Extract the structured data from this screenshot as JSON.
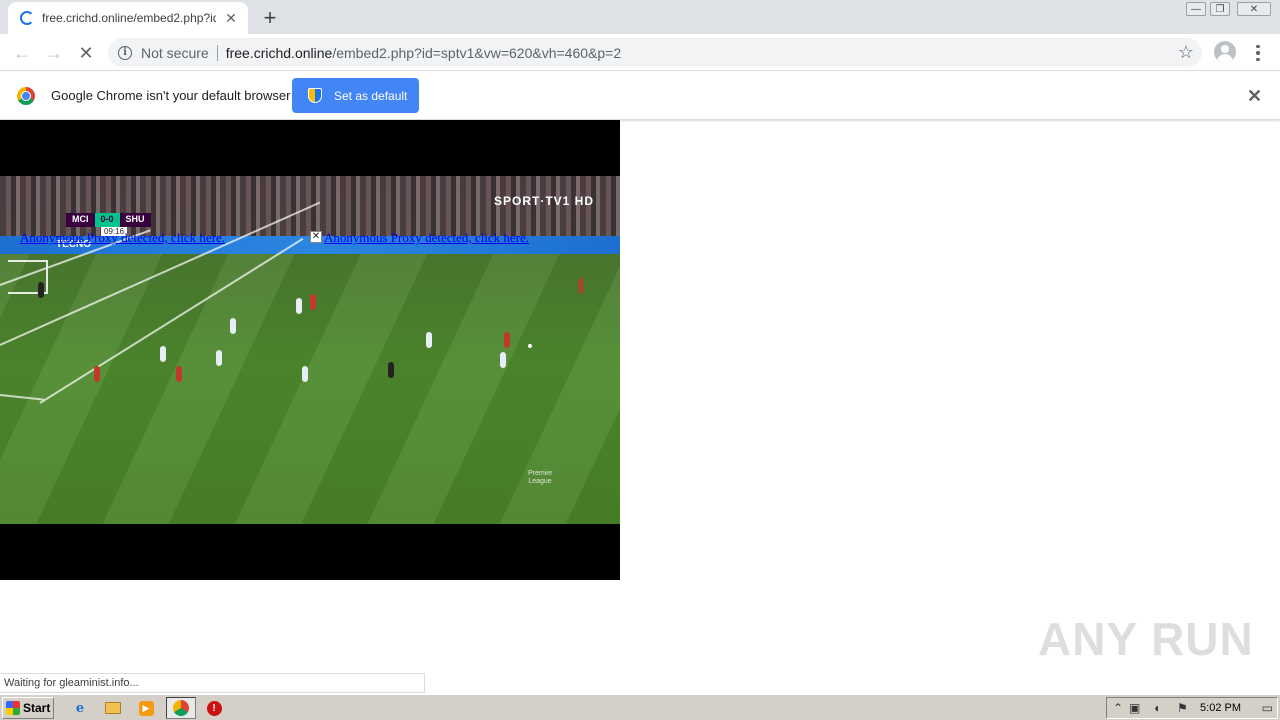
{
  "browser": {
    "tab_title": "free.crichd.online/embed2.php?id=sp",
    "tab_close": "✕",
    "new_tab": "+",
    "win_min": "—",
    "win_restore": "❐",
    "win_close": "✕",
    "nav_back": "←",
    "nav_forward": "→",
    "nav_stop": "✕",
    "security_label": "Not secure",
    "url_host": "free.crichd.online",
    "url_path": "/embed2.php?id=sptv1&vw=620&vh=460&p=2",
    "bookmark_star": "☆",
    "status_text": "Waiting for gleaminist.info..."
  },
  "infobar": {
    "message": "Google Chrome isn't your default browser",
    "button_label": "Set as default",
    "close": "✕"
  },
  "video": {
    "home_team": "MCI",
    "away_team": "SHU",
    "score": "0-0",
    "match_time": "09:16",
    "channel": "SPORT·TV1 HD",
    "ad_text": "TECNO",
    "league_logo_text": "Premier League",
    "proxy_link_1": "Anonymous Proxy detected, click here.",
    "proxy_link_2": "Anonymous Proxy detected, click here.",
    "proxy_close": "✕"
  },
  "watermark": "ANY RUN",
  "taskbar": {
    "start_label": "Start",
    "clock": "5:02 PM"
  },
  "icons": [
    "spinner-icon",
    "close-icon",
    "plus-icon",
    "back-icon",
    "forward-icon",
    "stop-icon",
    "info-icon",
    "star-icon",
    "profile-icon",
    "menu-icon",
    "chrome-logo-icon",
    "shield-icon",
    "windows-flag-icon",
    "ie-icon",
    "folder-icon",
    "media-player-icon",
    "chrome-icon",
    "stop-sign-icon",
    "tray-arrow-icon",
    "network-icon",
    "volume-icon",
    "flag-icon",
    "monitor-icon"
  ],
  "colors": {
    "accent": "#4285f4",
    "link": "#0000ee",
    "tabstrip": "#dee1e6",
    "taskbar": "#d4d0c8"
  }
}
